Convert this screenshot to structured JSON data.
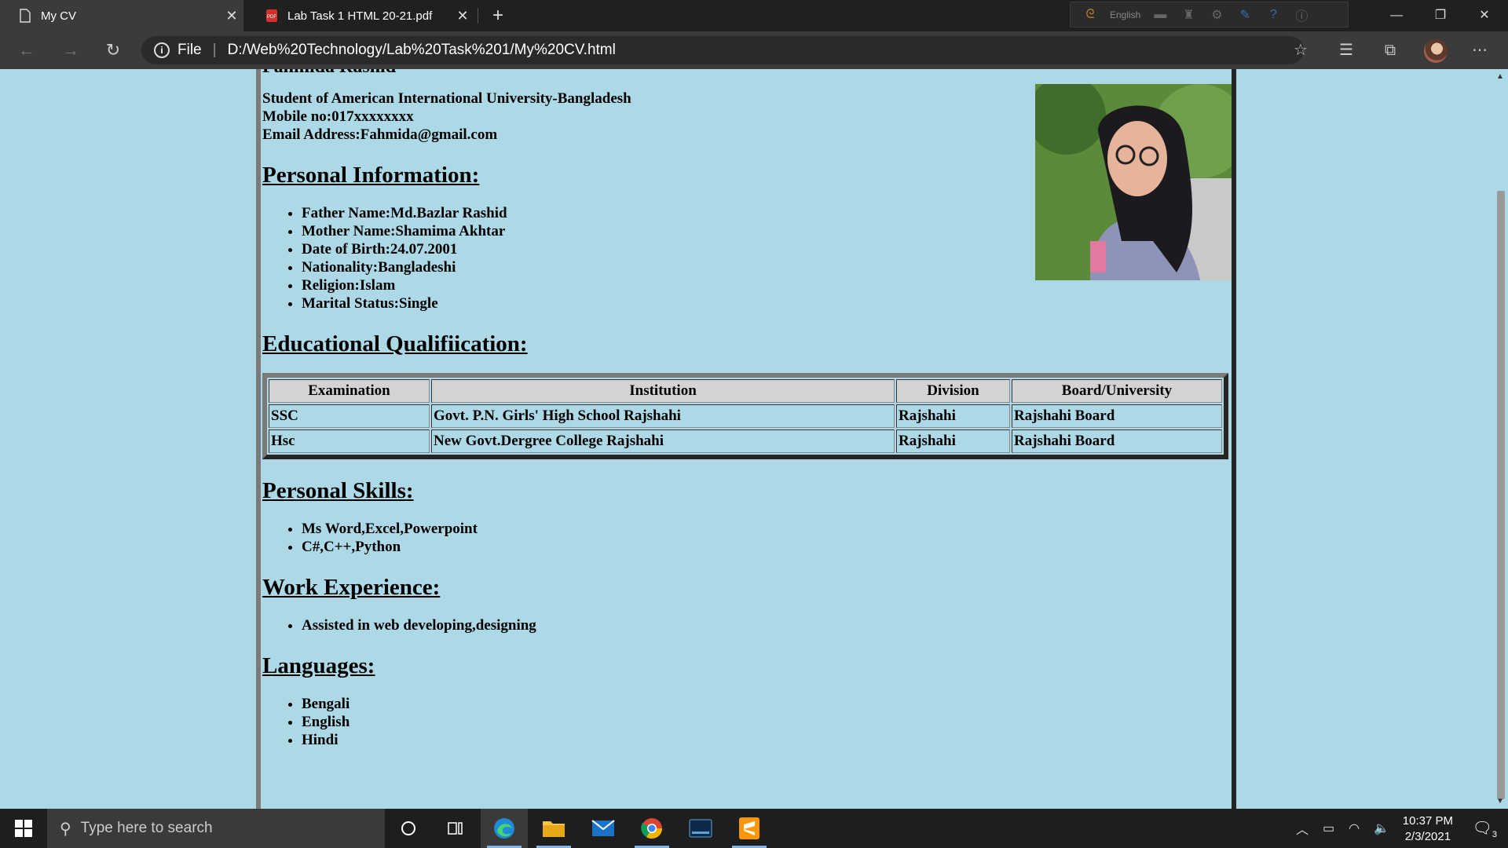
{
  "browser": {
    "tabs": [
      {
        "label": "My CV",
        "icon": "document-icon",
        "active": true
      },
      {
        "label": "Lab Task 1 HTML 20-21.pdf",
        "icon": "pdf-icon",
        "active": false
      }
    ],
    "ime_label": "English",
    "address": {
      "scheme_label": "File",
      "url": "D:/Web%20Technology/Lab%20Task%201/My%20CV.html"
    }
  },
  "cv": {
    "name": "Fahmida Rashid",
    "contact": [
      "Student of American International University-Bangladesh",
      "Mobile no:017xxxxxxxx",
      "Email Address:Fahmida@gmail.com"
    ],
    "sections": {
      "personal": {
        "heading": "Personal Information:",
        "items": [
          "Father Name:Md.Bazlar Rashid",
          "Mother Name:Shamima Akhtar",
          "Date of Birth:24.07.2001",
          "Nationality:Bangladeshi",
          "Religion:Islam",
          "Marital Status:Single"
        ]
      },
      "education": {
        "heading": "Educational Qualifiication:",
        "columns": [
          "Examination",
          "Institution",
          "Division",
          "Board/University"
        ],
        "rows": [
          [
            "SSC",
            "Govt. P.N. Girls' High School Rajshahi",
            "Rajshahi",
            "Rajshahi Board"
          ],
          [
            "Hsc",
            "New Govt.Dergree College Rajshahi",
            "Rajshahi",
            "Rajshahi Board"
          ]
        ]
      },
      "skills": {
        "heading": "Personal Skills:",
        "items": [
          "Ms Word,Excel,Powerpoint",
          "C#,C++,Python"
        ]
      },
      "work": {
        "heading": "Work Experience:",
        "items": [
          "Assisted in web developing,designing"
        ]
      },
      "languages": {
        "heading": "Languages:",
        "items": [
          "Bengali",
          "English",
          "Hindi"
        ]
      }
    }
  },
  "taskbar": {
    "search_placeholder": "Type here to search",
    "time": "10:37 PM",
    "date": "2/3/2021",
    "notification_count": "3"
  },
  "colors": {
    "page_background": "#add8e6",
    "table_header": "#d3d3d3"
  }
}
